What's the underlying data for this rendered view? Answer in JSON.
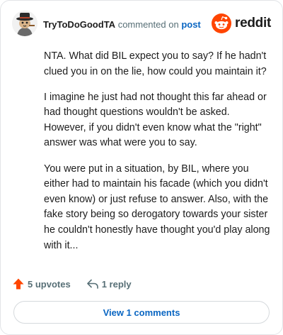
{
  "comment": {
    "username": "TryToDoGoodTA",
    "action_text": "commented on",
    "post_link": "post",
    "paragraphs": [
      "NTA. What did BIL expect you to say? If he hadn't clued you in on the lie, how could you maintain it?",
      "I imagine he just had not thought this far ahead or had thought questions wouldn't be asked. However, if you didn't even know what the \"right\" answer was what were you to say.",
      "You were put in a situation, by BIL, where you either had to maintain his facade (which you didn't even know) or just refuse to answer. Also, with the fake story being so derogatory towards your sister he couldn't honestly have thought you'd play along with it..."
    ]
  },
  "brand": {
    "name": "reddit",
    "color": "#ff4500"
  },
  "actions": {
    "upvotes": "5 upvotes",
    "replies": "1 reply"
  },
  "view_comments_label": "View 1 comments",
  "icons": {
    "avatar": "avatar-cat-with-hat",
    "upvote": "upvote-arrow-icon",
    "reply": "reply-arrow-icon"
  }
}
